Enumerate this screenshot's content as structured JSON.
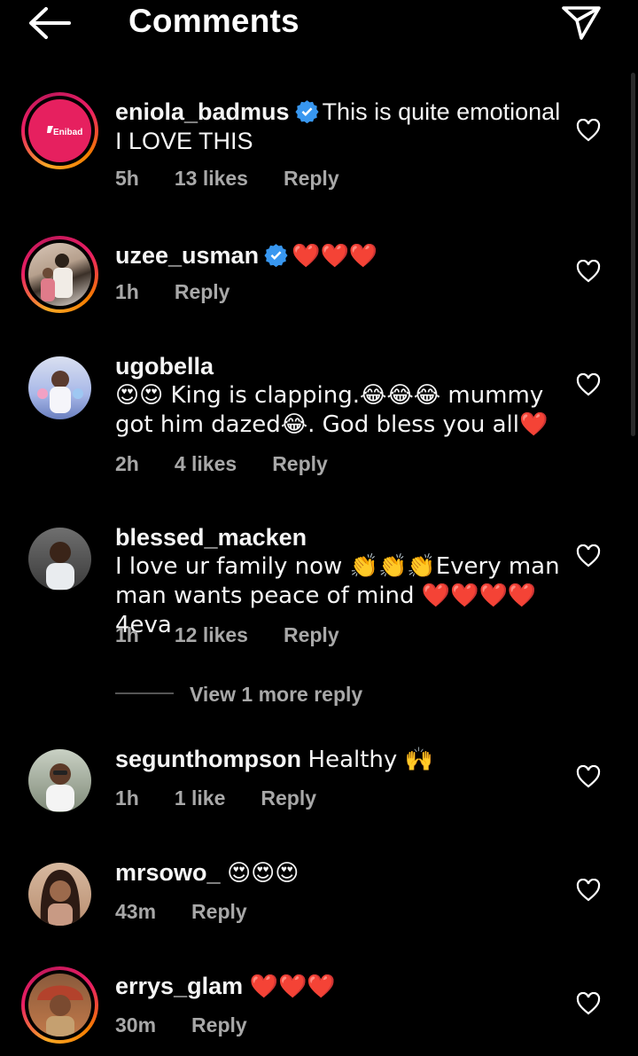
{
  "header": {
    "title": "Comments"
  },
  "comments": [
    {
      "username": "eniola_badmus",
      "verified": true,
      "text": "This is quite emotional I LOVE THIS",
      "time": "5h",
      "likes": "13 likes",
      "reply": "Reply",
      "avatar_text": "Enibad"
    },
    {
      "username": "uzee_usman",
      "verified": true,
      "text": "❤️❤️❤️",
      "time": "1h",
      "likes": "",
      "reply": "Reply"
    },
    {
      "username": "ugobella",
      "verified": false,
      "text": "😍😍 King is clapping.😂😂😂 mummy got him dazed😂. God bless you all❤️",
      "time": "2h",
      "likes": "4 likes",
      "reply": "Reply"
    },
    {
      "username": "blessed_macken",
      "verified": false,
      "text": "I love ur family now 👏👏👏Every man man wants peace of mind ❤️❤️❤️❤️4eva",
      "time": "1h",
      "likes": "12 likes",
      "reply": "Reply"
    },
    {
      "username": "segunthompson",
      "verified": false,
      "text": "Healthy 🙌",
      "time": "1h",
      "likes": "1 like",
      "reply": "Reply"
    },
    {
      "username": "mrsowo_",
      "verified": false,
      "text": "😍😍😍",
      "time": "43m",
      "likes": "",
      "reply": "Reply"
    },
    {
      "username": "errys_glam",
      "verified": false,
      "text": "❤️❤️❤️",
      "time": "30m",
      "likes": "",
      "reply": "Reply"
    }
  ],
  "view_more": "View 1 more reply",
  "colors": {
    "background": "#000000",
    "text": "#f5f5f5",
    "muted": "#a8a8a8",
    "verified": "#3897f0",
    "heart_emoji": "#e0245e"
  }
}
